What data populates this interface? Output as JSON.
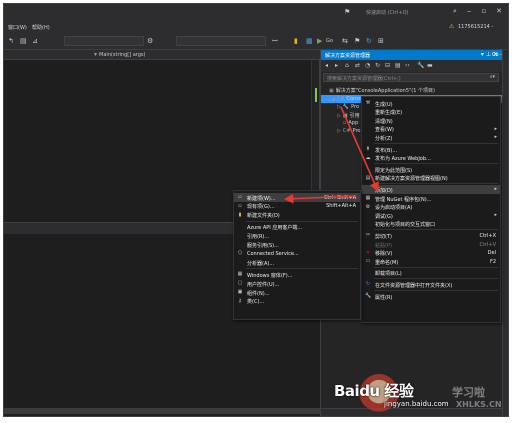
{
  "titlebar": {
    "quick_launch": "快速启动 (Ctrl+Q)"
  },
  "menubar": {
    "items": [
      "窗口(W)",
      "帮助(H)"
    ],
    "user": "1175615214 -"
  },
  "editor": {
    "nav_text": "Main(string[] args)"
  },
  "toolbar": {
    "start_label": "Go"
  },
  "solution_explorer": {
    "title": "解决方案资源管理器",
    "search_placeholder": "搜索解决方案资源管理器(Ctrl+;)",
    "tree": [
      {
        "text": "解决方案\"ConsoleApplication5\"(1 个项目)",
        "indent": 0
      },
      {
        "text": "ConsoleApplication5",
        "indent": 1,
        "selected": true
      },
      {
        "text": "Pro",
        "indent": 2
      },
      {
        "text": "引用",
        "indent": 2
      },
      {
        "text": "App",
        "indent": 2
      },
      {
        "text": "Pro",
        "indent": 2
      }
    ]
  },
  "properties_tab": "Co -",
  "project_menu": {
    "items": [
      {
        "icon": "⚒",
        "label": "生成(U)"
      },
      {
        "icon": "",
        "label": "重新生成(E)"
      },
      {
        "icon": "",
        "label": "清理(N)"
      },
      {
        "icon": "",
        "label": "查看(W)",
        "submenu": true
      },
      {
        "icon": "",
        "label": "分析(Z)",
        "submenu": true
      },
      {
        "sep": true
      },
      {
        "icon": "⬆",
        "label": "发布(B)..."
      },
      {
        "icon": "☁",
        "label": "发布为 Azure WebJob..."
      },
      {
        "sep": true
      },
      {
        "icon": "",
        "label": "限定为此范围(S)"
      },
      {
        "icon": "▤",
        "label": "新建解决方案资源管理器视图(N)"
      },
      {
        "sep": true
      },
      {
        "icon": "",
        "label": "添加(D)",
        "submenu": true,
        "highlight": true
      },
      {
        "icon": "▦",
        "label": "管理 NuGet 程序包(N)..."
      },
      {
        "icon": "⚙",
        "label": "设为启动项目(A)"
      },
      {
        "icon": "",
        "label": "调试(G)",
        "submenu": true
      },
      {
        "icon": "",
        "label": "初始化与项目的交互式窗口"
      },
      {
        "sep": true
      },
      {
        "icon": "✂",
        "label": "剪切(T)",
        "shortcut": "Ctrl+X"
      },
      {
        "icon": "",
        "label": "粘贴(P)",
        "shortcut": "Ctrl+V",
        "disabled": true
      },
      {
        "icon": "✕",
        "label": "移除(V)",
        "shortcut": "Del",
        "red": true
      },
      {
        "icon": "▭",
        "label": "重命名(M)",
        "shortcut": "F2"
      },
      {
        "sep": true
      },
      {
        "icon": "",
        "label": "卸载项目(L)"
      },
      {
        "sep": true
      },
      {
        "icon": "↻",
        "label": "在文件资源管理器中打开文件夹(X)",
        "blue": true
      },
      {
        "sep": true
      },
      {
        "icon": "🔧",
        "label": "属性(R)"
      }
    ]
  },
  "add_menu": {
    "items": [
      {
        "icon": "▫",
        "label": "新建项(W)...",
        "shortcut": "Ctrl+Shift+A",
        "highlight": true
      },
      {
        "icon": "▫",
        "label": "现有项(G)...",
        "shortcut": "Shift+Alt+A"
      },
      {
        "icon": "▮",
        "label": "新建文件夹(D)",
        "amber": true
      },
      {
        "sep": true
      },
      {
        "icon": "",
        "label": "Azure API 应用客户端..."
      },
      {
        "icon": "",
        "label": "引用(R)..."
      },
      {
        "icon": "",
        "label": "服务引用(S)..."
      },
      {
        "icon": "⬡",
        "label": "Connected Service..."
      },
      {
        "icon": "",
        "label": "分析器(A)..."
      },
      {
        "sep": true
      },
      {
        "icon": "▦",
        "label": "Windows 窗体(F)..."
      },
      {
        "icon": "▢",
        "label": "用户控件(U)..."
      },
      {
        "icon": "▣",
        "label": "组件(N)..."
      },
      {
        "icon": "⚷",
        "label": "类(C)..."
      }
    ]
  },
  "watermark": {
    "brand": "Baidu 经验",
    "url": "jingyan.baidu.com",
    "site_cn": "学习啦",
    "site_en": "XHLKS.CN"
  },
  "colors": {
    "accent": "#007acc",
    "selection": "#3399ff",
    "menu_bg": "#1b1b1c",
    "arrow": "#e53935"
  }
}
